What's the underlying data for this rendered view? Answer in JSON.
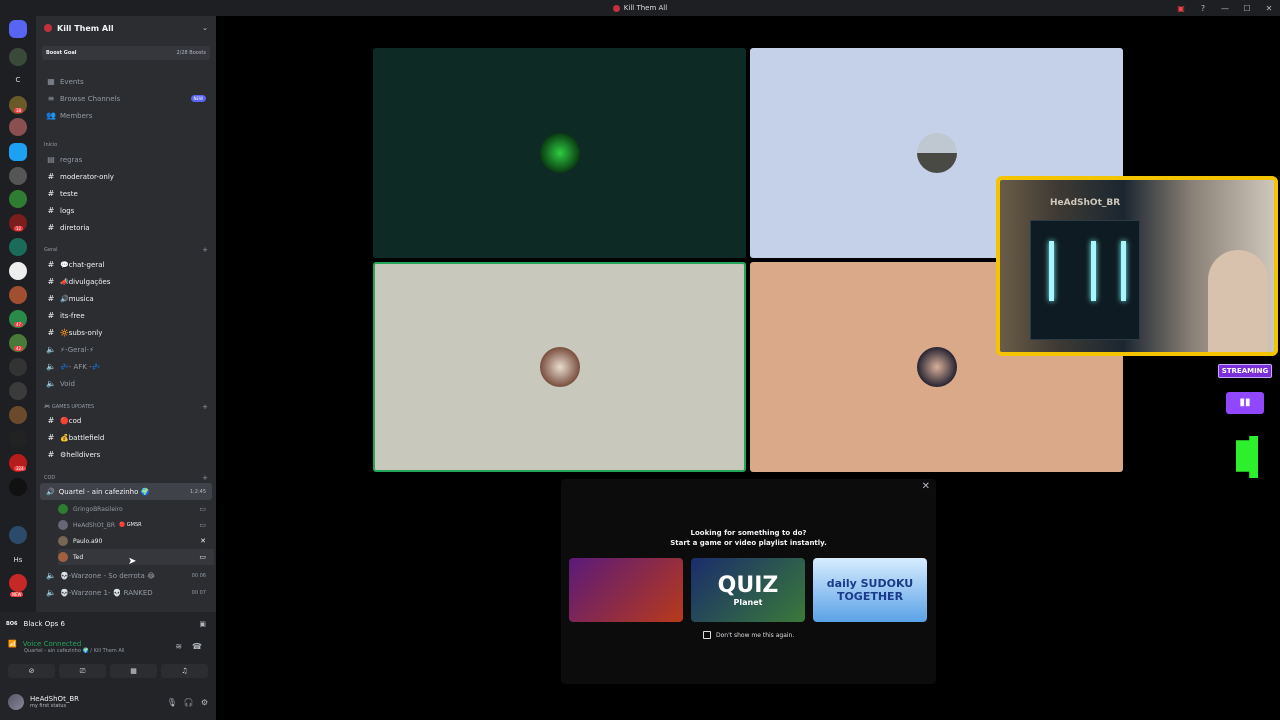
{
  "window": {
    "title": "Kill Them All"
  },
  "rail": {
    "server_badges": [
      "38",
      "12",
      "47",
      "42",
      "1",
      "87",
      "324"
    ],
    "dm_text": "C",
    "hs_text": "Hs",
    "new_label": "NEW"
  },
  "server": {
    "name": "Kill Them All",
    "boost": {
      "label": "Boost Goal",
      "progress": "2/28 Boosts"
    },
    "top_items": [
      {
        "label": "Events"
      },
      {
        "label": "Browse Channels",
        "badge": "NEW"
      },
      {
        "label": "Members"
      }
    ],
    "category_inicio": "Início",
    "channels_inicio": [
      "regras",
      "moderator-only",
      "teste",
      "logs",
      "diretoria"
    ],
    "category_geral": "Geral",
    "channels_geral": [
      "💬chat-geral",
      "📣divulgações",
      "🔊musica",
      "its-free",
      "🔆subs-only"
    ],
    "voice_geral": [
      "⚡-Geral-⚡",
      "💤- AFK -💤",
      "Void"
    ],
    "category_games": "🎮 GAMES UPDATES",
    "channels_games": [
      "🔴cod",
      "💰battlefield",
      "⚙helldivers"
    ],
    "category_cod": "COD",
    "active_voice": {
      "label": "Quartel - ain cafezinho 🌍",
      "timer": "1:2:45"
    },
    "members": [
      {
        "name": "GringoBRasileiro"
      },
      {
        "name": "HeAdShOt_BR",
        "tag": "🔴 GMSR"
      },
      {
        "name": "Paulo.a90"
      },
      {
        "name": "Ted"
      }
    ],
    "voice_more": [
      {
        "label": "💀-Warzone - So derrota 😂",
        "count": "00 06"
      },
      {
        "label": "💀-Warzone 1- 💀 RANKED",
        "count": "00 07"
      }
    ]
  },
  "activity": {
    "logo": "BO6",
    "label": "Black Ops 6"
  },
  "voice": {
    "status": "Voice Connected",
    "channel": "Quartel - ain cafezinho 🌍 / Kill Them All"
  },
  "user": {
    "name": "HeAdShOt_BR",
    "status": "my first status"
  },
  "stage": {
    "tiles": [
      {
        "bg": "#0e2a24"
      },
      {
        "bg": "#c4d1e8"
      },
      {
        "bg": "#c8c9bc"
      },
      {
        "bg": "#d9a98a"
      }
    ],
    "panel": {
      "heading1": "Looking for something to do?",
      "heading2": "Start a game or video playlist instantly.",
      "games": [
        {
          "label": "",
          "bg": "#3a1a52"
        },
        {
          "label": "QUIZ",
          "sub": "Planet",
          "bg": "#1a2c6b"
        },
        {
          "label": "daily SUDOKU TOGETHER",
          "bg": "#5aa2e6"
        }
      ],
      "dontshow": "Don't show me this again."
    },
    "webcam_text": "HeAdShOt_BR",
    "streaming_label": "STREAMING"
  }
}
